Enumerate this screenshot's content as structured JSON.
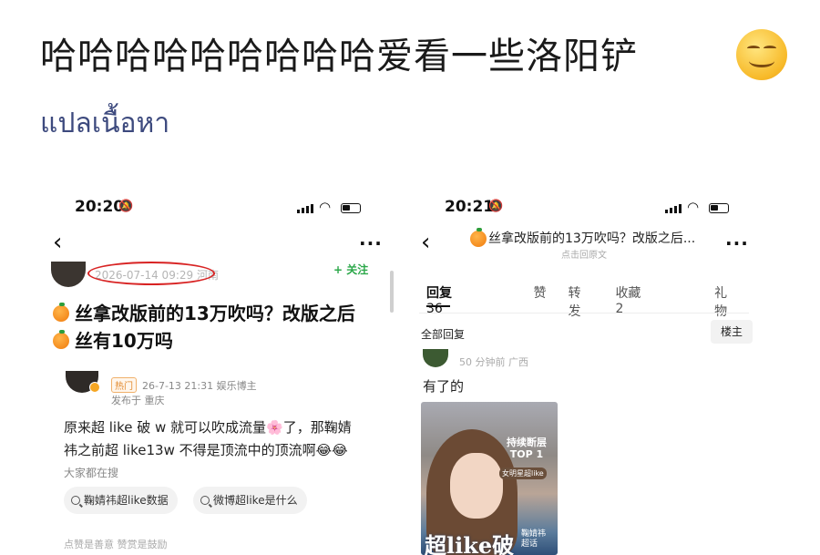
{
  "post": {
    "title": "哈哈哈哈哈哈哈哈哈爱看一些洛阳铲",
    "translate_label": "แปลเนื้อหา"
  },
  "left_screen": {
    "status_time": "20:20",
    "date": "2026-07-14 09:29 河南",
    "follow_label": "+ 关注",
    "headline_line1": "丝拿改版前的13万吹吗？改版之后",
    "headline_line2": "丝有10万吗",
    "quoted_post": {
      "hot_tag": "热门",
      "meta": "26-7-13 21:31  娱乐博主",
      "location": "发布于 重庆",
      "body_line1": "原来超 like 破 w 就可以吹成流量🌸了，那鞠婧",
      "body_line2": "祎之前超 like13w 不得是顶流中的顶流啊😂😂"
    },
    "search_label": "大家都在搜",
    "search_chips": [
      "鞠婧祎超like数据",
      "微博超like是什么"
    ],
    "bottom_cut_text": "点赞是善意  赞赏是鼓励"
  },
  "right_screen": {
    "status_time": "20:21",
    "header_title": "丝拿改版前的13万吹吗？改版之后...",
    "header_sub": "点击回原文",
    "tabs": [
      {
        "label": "回复",
        "count": "36"
      },
      {
        "label": "赞"
      },
      {
        "label": "转发"
      },
      {
        "label": "收藏",
        "count": "2"
      },
      {
        "label": "礼物"
      }
    ],
    "all_replies_label": "全部回复",
    "op_label": "楼主",
    "reply": {
      "meta": "50 分钟前 广西",
      "text": "有了的",
      "image": {
        "tag1_line1": "持续断层",
        "tag1_line2": "TOP 1",
        "tag2": "女明星超like",
        "big_text": "超like破",
        "side_line1": "鞠婧祎",
        "side_line2": "超话"
      }
    }
  }
}
